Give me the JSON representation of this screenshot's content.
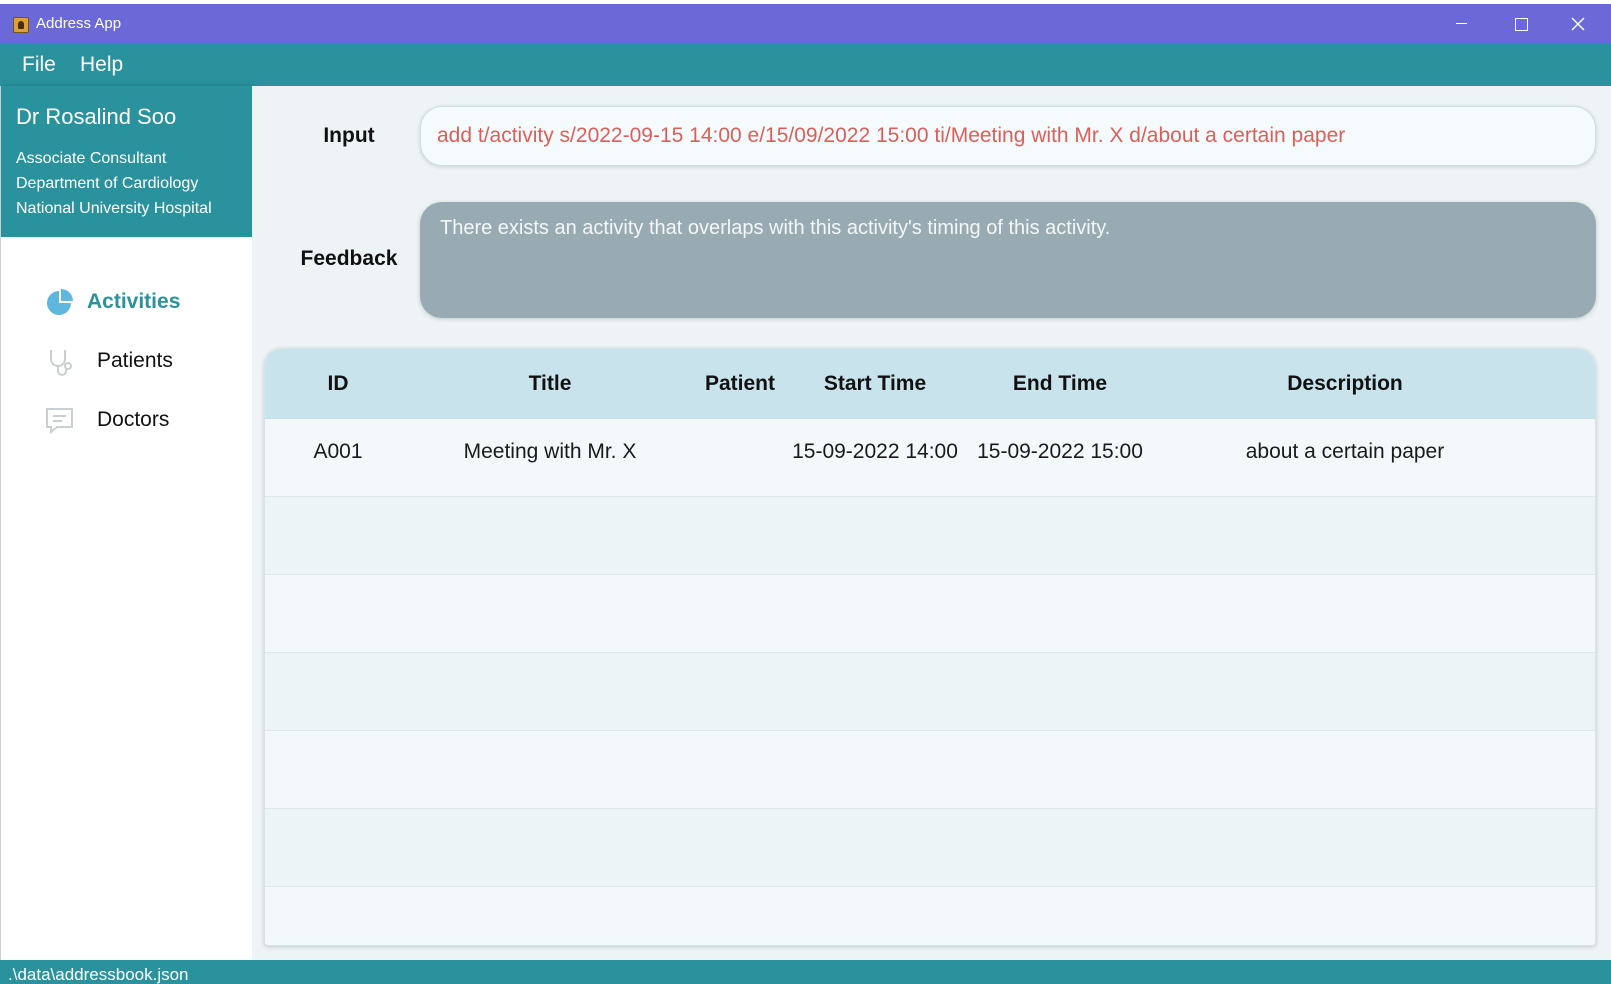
{
  "window": {
    "title": "Address App",
    "icon": "address-book-icon"
  },
  "menu": {
    "file": "File",
    "help": "Help"
  },
  "profile": {
    "name": "Dr Rosalind Soo",
    "position": "Associate Consultant",
    "department": "Department of Cardiology",
    "hospital": "National University Hospital"
  },
  "nav": {
    "items": [
      {
        "label": "Activities",
        "icon": "pie-chart-icon",
        "active": true
      },
      {
        "label": "Patients",
        "icon": "stethoscope-icon",
        "active": false
      },
      {
        "label": "Doctors",
        "icon": "chat-bubble-icon",
        "active": false
      }
    ]
  },
  "input": {
    "label": "Input",
    "value": "add t/activity s/2022-09-15 14:00 e/15/09/2022 15:00 ti/Meeting with Mr. X d/about a certain paper"
  },
  "feedback": {
    "label": "Feedback",
    "text": "There exists an activity that overlaps with this activity's timing of this activity."
  },
  "table": {
    "columns": [
      "ID",
      "Title",
      "Patient",
      "Start Time",
      "End Time",
      "Description"
    ],
    "rows": [
      {
        "id": "A001",
        "title": "Meeting with Mr. X",
        "patient": "",
        "start": "15-09-2022 14:00",
        "end": "15-09-2022 15:00",
        "description": "about a certain paper"
      }
    ]
  },
  "status": {
    "path": ".\\data\\addressbook.json"
  },
  "colors": {
    "titlebar": "#6b68d8",
    "teal": "#2a929d",
    "input_text": "#d9605a",
    "feedback_bg": "#98abb3",
    "table_header": "#c8e3ec"
  }
}
